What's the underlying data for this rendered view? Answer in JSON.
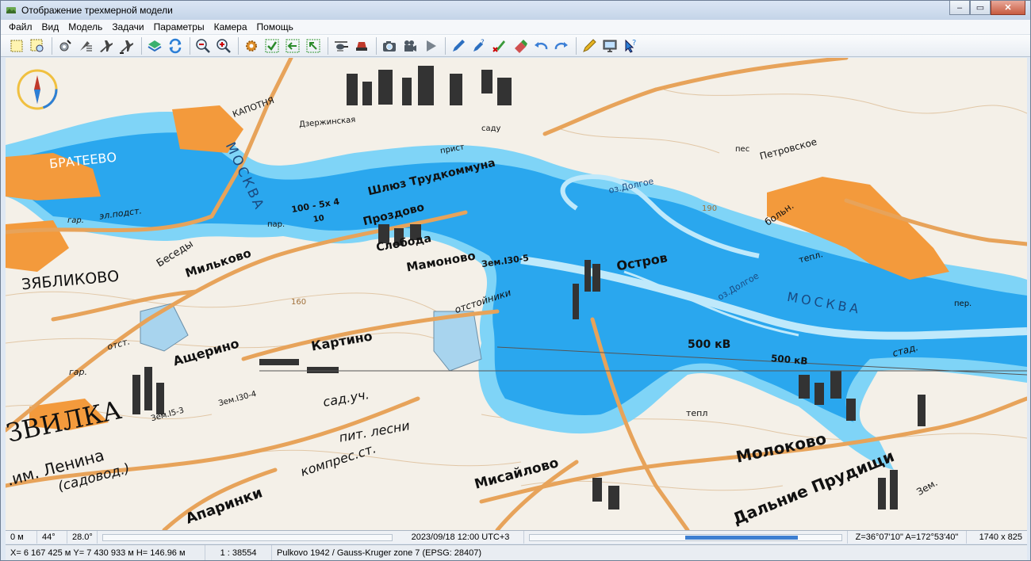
{
  "window": {
    "title": "Отображение трехмерной модели",
    "controls": [
      "‒",
      "▭",
      "✕"
    ]
  },
  "menu": [
    "Файл",
    "Вид",
    "Модель",
    "Задачи",
    "Параметры",
    "Камера",
    "Помощь"
  ],
  "toolbar": {
    "icons": [
      "select-rect-icon",
      "select-zoom-icon",
      "model-settings-icon",
      "model-list-icon",
      "plane-icon",
      "plane-route-icon",
      "layers-icon",
      "refresh-icon",
      "zoom-out-icon",
      "zoom-in-icon",
      "settings-gear-icon",
      "check-all-icon",
      "arrow-left-check-icon",
      "arrow-back-check-icon",
      "helicopter-icon",
      "car-icon",
      "camera-icon",
      "video-camera-icon",
      "play-icon",
      "pen-icon",
      "help-pen-icon",
      "cross-marker-icon",
      "eraser-icon",
      "undo-icon",
      "redo-icon",
      "pencil-ruler-icon",
      "monitor-icon",
      "help-cursor-icon"
    ]
  },
  "map": {
    "labels": {
      "brateevo": "БРАТЕЕВО",
      "moskva1": "МОСКВА",
      "shluz": "Шлюз Трудкоммуна",
      "sluice_dims": "100 - 5х 4",
      "sluice_dims2": "10",
      "prozdovo": "Проздово",
      "sloboda": "Слобода",
      "mamonovo": "Мамоново",
      "zem130": "Зем.I30-5",
      "ostrov": "Остров",
      "zyablikovo": "ЗЯБЛИКОВО",
      "milkovo": "Мильково",
      "besedy": "Беседы",
      "ashcherino": "Ащерино",
      "kartino": "Картино",
      "razvilka": "ЗВИЛКА",
      "lenina": ".им. Ленина",
      "sadovod": "(садовод.)",
      "aparinki": "Апаринки",
      "misaylovo": "Мисайлово",
      "molokovo": "Молоково",
      "dalnie": "Дальние Прудищи",
      "kv500a": "500 кВ",
      "kv500b": "500 кВ",
      "moskva2": "МОСКВА",
      "ozdolgoe1": "оз.Долгое",
      "ozdolgoe2": "оз.Долгое",
      "otstoyniki": "отстойники",
      "sad": "сад.уч.",
      "pit": "пит. лесни",
      "kompres": "компрес.ст.",
      "dzerzh": "Дзержинская",
      "kapotnya": "КАПОТНЯ",
      "petrovskoe": "Петровское",
      "boln": "больн.",
      "tepl1": "тепл.",
      "tepl2": "тепл",
      "stad": "стад.",
      "zem1304": "Зем.I30-4",
      "zem153": "Зем.I5-3",
      "pristan": "прист",
      "elpodst": "эл.подст.",
      "gar1": "гар.",
      "gar2": "гар.",
      "par": "пар.",
      "pes": "пес",
      "otst": "отст.",
      "zem_right": "Зем.",
      "sadu": "саду",
      "per": "пер.",
      "n160": "160",
      "n190": "190"
    }
  },
  "status": {
    "distance": "0 м",
    "angle": "44°",
    "tilt": "28.0°",
    "datetime": "2023/09/18   12:00   UTC+3",
    "orientation": "Z=36°07'10\"   A=172°53'40\"",
    "resolution": "1740 x 825",
    "time_slider": 0.86,
    "coords": "X= 6 167 425 м  Y= 7 430 933 м  H= 146.96 м",
    "scale": "1 : 38554",
    "crs": "Pulkovo 1942 / Gauss-Kruger zone 7 (EPSG: 28407)"
  },
  "colors": {
    "water": "#2aa7ee",
    "water_light": "#7fd4f7",
    "road": "#e7a35a",
    "urban": "#f39a3c",
    "paper": "#f4f0e8",
    "accent": "#3d7fd1"
  }
}
